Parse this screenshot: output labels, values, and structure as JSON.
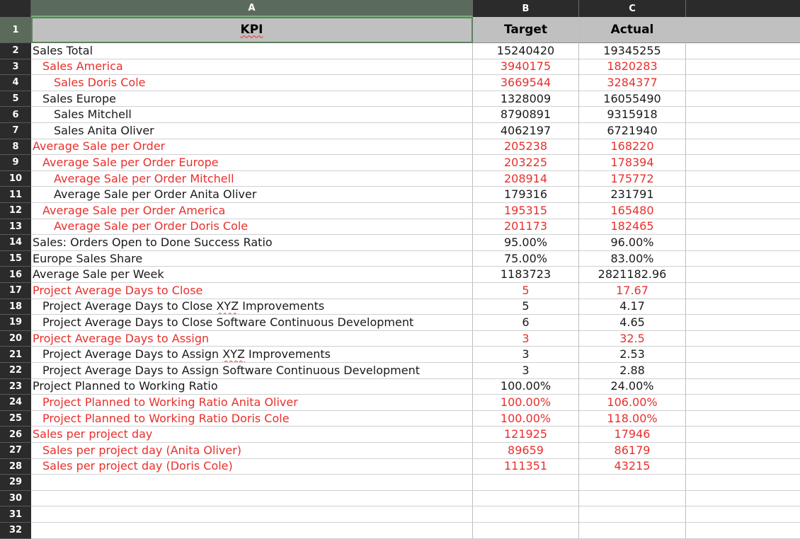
{
  "columns": [
    {
      "letter": "A"
    },
    {
      "letter": "B"
    },
    {
      "letter": "C"
    }
  ],
  "header": {
    "kpi": "KPI",
    "target": "Target",
    "actual": "Actual"
  },
  "rows": [
    {
      "num": "2",
      "kpi": "Sales Total",
      "target": "15240420",
      "actual": "19345255",
      "color": "black",
      "indent": 0
    },
    {
      "num": "3",
      "kpi": "Sales America",
      "target": "3940175",
      "actual": "1820283",
      "color": "red",
      "indent": 1
    },
    {
      "num": "4",
      "kpi": "Sales Doris Cole",
      "target": "3669544",
      "actual": "3284377",
      "color": "red",
      "indent": 2
    },
    {
      "num": "5",
      "kpi": "Sales Europe",
      "target": "1328009",
      "actual": "16055490",
      "color": "black",
      "indent": 1
    },
    {
      "num": "6",
      "kpi": "Sales Mitchell",
      "target": "8790891",
      "actual": "9315918",
      "color": "black",
      "indent": 2
    },
    {
      "num": "7",
      "kpi": "Sales Anita Oliver",
      "target": "4062197",
      "actual": "6721940",
      "color": "black",
      "indent": 2
    },
    {
      "num": "8",
      "kpi": "Average Sale per Order",
      "target": "205238",
      "actual": "168220",
      "color": "red",
      "indent": 0
    },
    {
      "num": "9",
      "kpi": "Average Sale per Order Europe",
      "target": "203225",
      "actual": "178394",
      "color": "red",
      "indent": 1
    },
    {
      "num": "10",
      "kpi": "Average Sale per Order Mitchell",
      "target": "208914",
      "actual": "175772",
      "color": "red",
      "indent": 2
    },
    {
      "num": "11",
      "kpi": "Average Sale per Order Anita Oliver",
      "target": "179316",
      "actual": "231791",
      "color": "black",
      "indent": 2
    },
    {
      "num": "12",
      "kpi": "Average Sale per Order America",
      "target": "195315",
      "actual": "165480",
      "color": "red",
      "indent": 1
    },
    {
      "num": "13",
      "kpi": "Average Sale per Order Doris Cole",
      "target": "201173",
      "actual": "182465",
      "color": "red",
      "indent": 2
    },
    {
      "num": "14",
      "kpi": "Sales: Orders Open to Done Success Ratio",
      "target": "95.00%",
      "actual": "96.00%",
      "color": "black",
      "indent": 0
    },
    {
      "num": "15",
      "kpi": "Europe Sales Share",
      "target": "75.00%",
      "actual": "83.00%",
      "color": "black",
      "indent": 0
    },
    {
      "num": "16",
      "kpi": "Average Sale per Week",
      "target": "1183723",
      "actual": "2821182.96",
      "color": "black",
      "indent": 0
    },
    {
      "num": "17",
      "kpi": "Project Average Days to Close",
      "target": "5",
      "actual": "17.67",
      "color": "red",
      "indent": 0
    },
    {
      "num": "18",
      "kpi_pre": "Project Average Days to Close ",
      "kpi_sq": "XYZ",
      "kpi_post": " Improvements",
      "target": "5",
      "actual": "4.17",
      "color": "black",
      "indent": 1
    },
    {
      "num": "19",
      "kpi": "Project Average Days to Close Software Continuous Development",
      "target": "6",
      "actual": "4.65",
      "color": "black",
      "indent": 1
    },
    {
      "num": "20",
      "kpi": "Project Average Days to Assign",
      "target": "3",
      "actual": "32.5",
      "color": "red",
      "indent": 0
    },
    {
      "num": "21",
      "kpi_pre": "Project Average Days to Assign ",
      "kpi_sq": "XYZ",
      "kpi_post": " Improvements",
      "target": "3",
      "actual": "2.53",
      "color": "black",
      "indent": 1
    },
    {
      "num": "22",
      "kpi": "Project Average Days to Assign Software Continuous Development",
      "target": "3",
      "actual": "2.88",
      "color": "black",
      "indent": 1
    },
    {
      "num": "23",
      "kpi": "Project Planned to Working Ratio",
      "target": "100.00%",
      "actual": "24.00%",
      "color": "black",
      "indent": 0
    },
    {
      "num": "24",
      "kpi": "Project Planned to Working Ratio Anita Oliver",
      "target": "100.00%",
      "actual": "106.00%",
      "color": "red",
      "indent": 1
    },
    {
      "num": "25",
      "kpi": "Project Planned to Working Ratio Doris Cole",
      "target": "100.00%",
      "actual": "118.00%",
      "color": "red",
      "indent": 1
    },
    {
      "num": "26",
      "kpi": "Sales per project day",
      "target": "121925",
      "actual": "17946",
      "color": "red",
      "indent": 0
    },
    {
      "num": "27",
      "kpi": "Sales per project day (Anita Oliver)",
      "target": "89659",
      "actual": "86179",
      "color": "red",
      "indent": 1
    },
    {
      "num": "28",
      "kpi": "Sales per project day (Doris Cole)",
      "target": "111351",
      "actual": "43215",
      "color": "red",
      "indent": 1
    },
    {
      "num": "29",
      "kpi": "",
      "target": "",
      "actual": "",
      "color": "black",
      "indent": 0
    },
    {
      "num": "30",
      "kpi": "",
      "target": "",
      "actual": "",
      "color": "black",
      "indent": 0
    },
    {
      "num": "31",
      "kpi": "",
      "target": "",
      "actual": "",
      "color": "black",
      "indent": 0
    },
    {
      "num": "32",
      "kpi": "",
      "target": "",
      "actual": "",
      "color": "black",
      "indent": 0
    }
  ],
  "header_row_num": "1",
  "colors": {
    "red": "#e8302c",
    "black": "#1a1a1a",
    "header_bg": "#2b2b2b",
    "header_row_bg": "#c0c0c0"
  }
}
